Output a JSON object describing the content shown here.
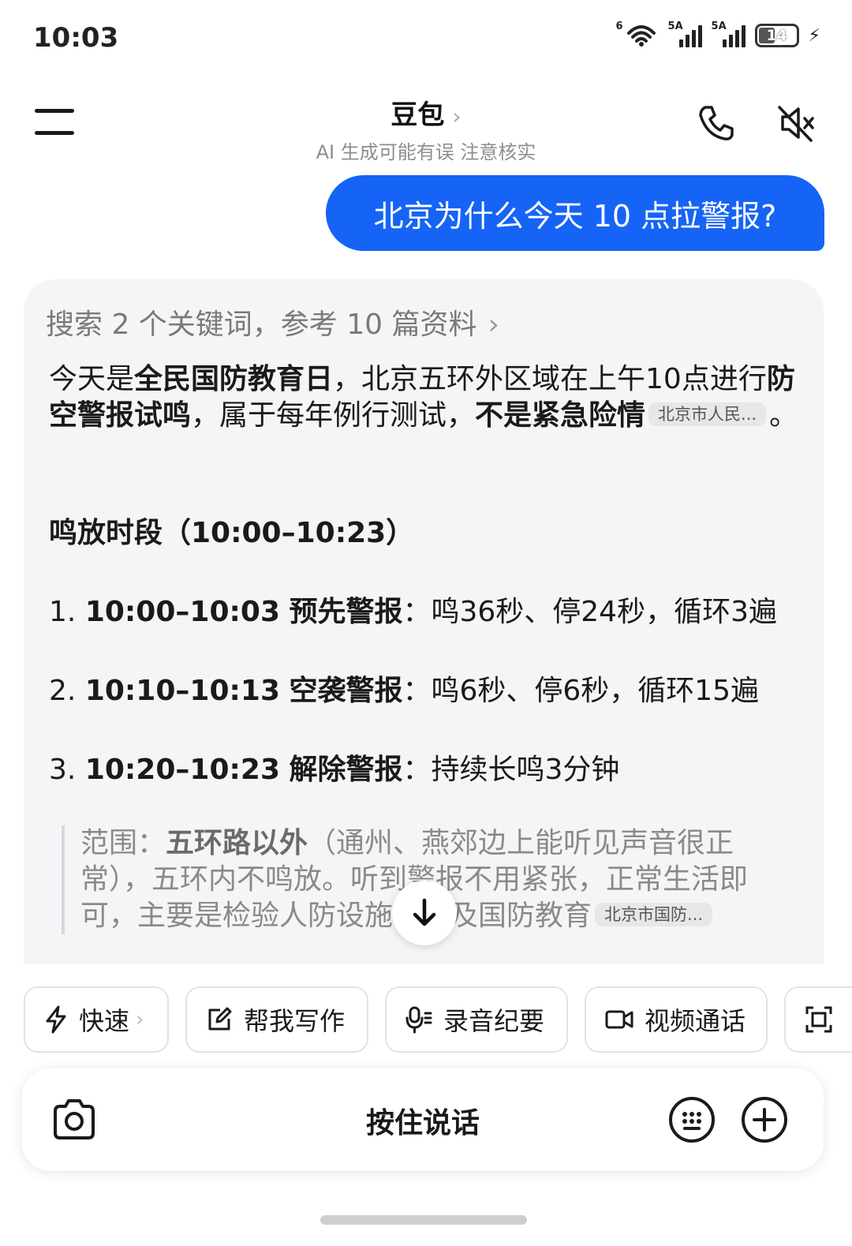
{
  "status_bar": {
    "time": "10:03",
    "wifi_label": "6",
    "signal1_label": "5A",
    "signal2_label": "5A",
    "battery": "14"
  },
  "header": {
    "title": "豆包",
    "chevron": "›",
    "subtitle": "AI 生成可能有误 注意核实"
  },
  "user_message": "北京为什么今天 10 点拉警报?",
  "answer": {
    "search_summary": "搜索 2 个关键词，参考 10 篇资料",
    "search_chevron": "›",
    "p1": {
      "t1": "今天是",
      "b1": "全民国防教育日",
      "t2": "，北京五环外区域在上午10点进行",
      "b2": "防空警报试鸣",
      "t3": "，属于每年例行测试，",
      "b3": "不是紧急险情",
      "ref": "北京市人民...",
      "t4": "。"
    },
    "section_title": "鸣放时段（10:00–10:23）",
    "items": [
      {
        "num": "1.",
        "time": "10:00–10:03",
        "name": "预先警报",
        "desc": "：鸣36秒、停24秒，循环3遍"
      },
      {
        "num": "2.",
        "time": "10:10–10:13",
        "name": "空袭警报",
        "desc": "：鸣6秒、停6秒，循环15遍"
      },
      {
        "num": "3.",
        "time": "10:20–10:23",
        "name": "解除警报",
        "desc": "：持续长鸣3分钟"
      }
    ],
    "quote": {
      "label": "范围：",
      "bold": "五环路以外",
      "text": "（通州、燕郊边上能听见声音很正常），五环内不鸣放。听到警报不用紧张，正常生活即可，主要是检验人防设施、普及国防教育",
      "ref": "北京市国防..."
    }
  },
  "quick_actions": [
    {
      "label": "快速",
      "chevron": "›"
    },
    {
      "label": "帮我写作"
    },
    {
      "label": "录音纪要"
    },
    {
      "label": "视频通话"
    }
  ],
  "input_bar": {
    "hold_to_talk": "按住说话"
  }
}
